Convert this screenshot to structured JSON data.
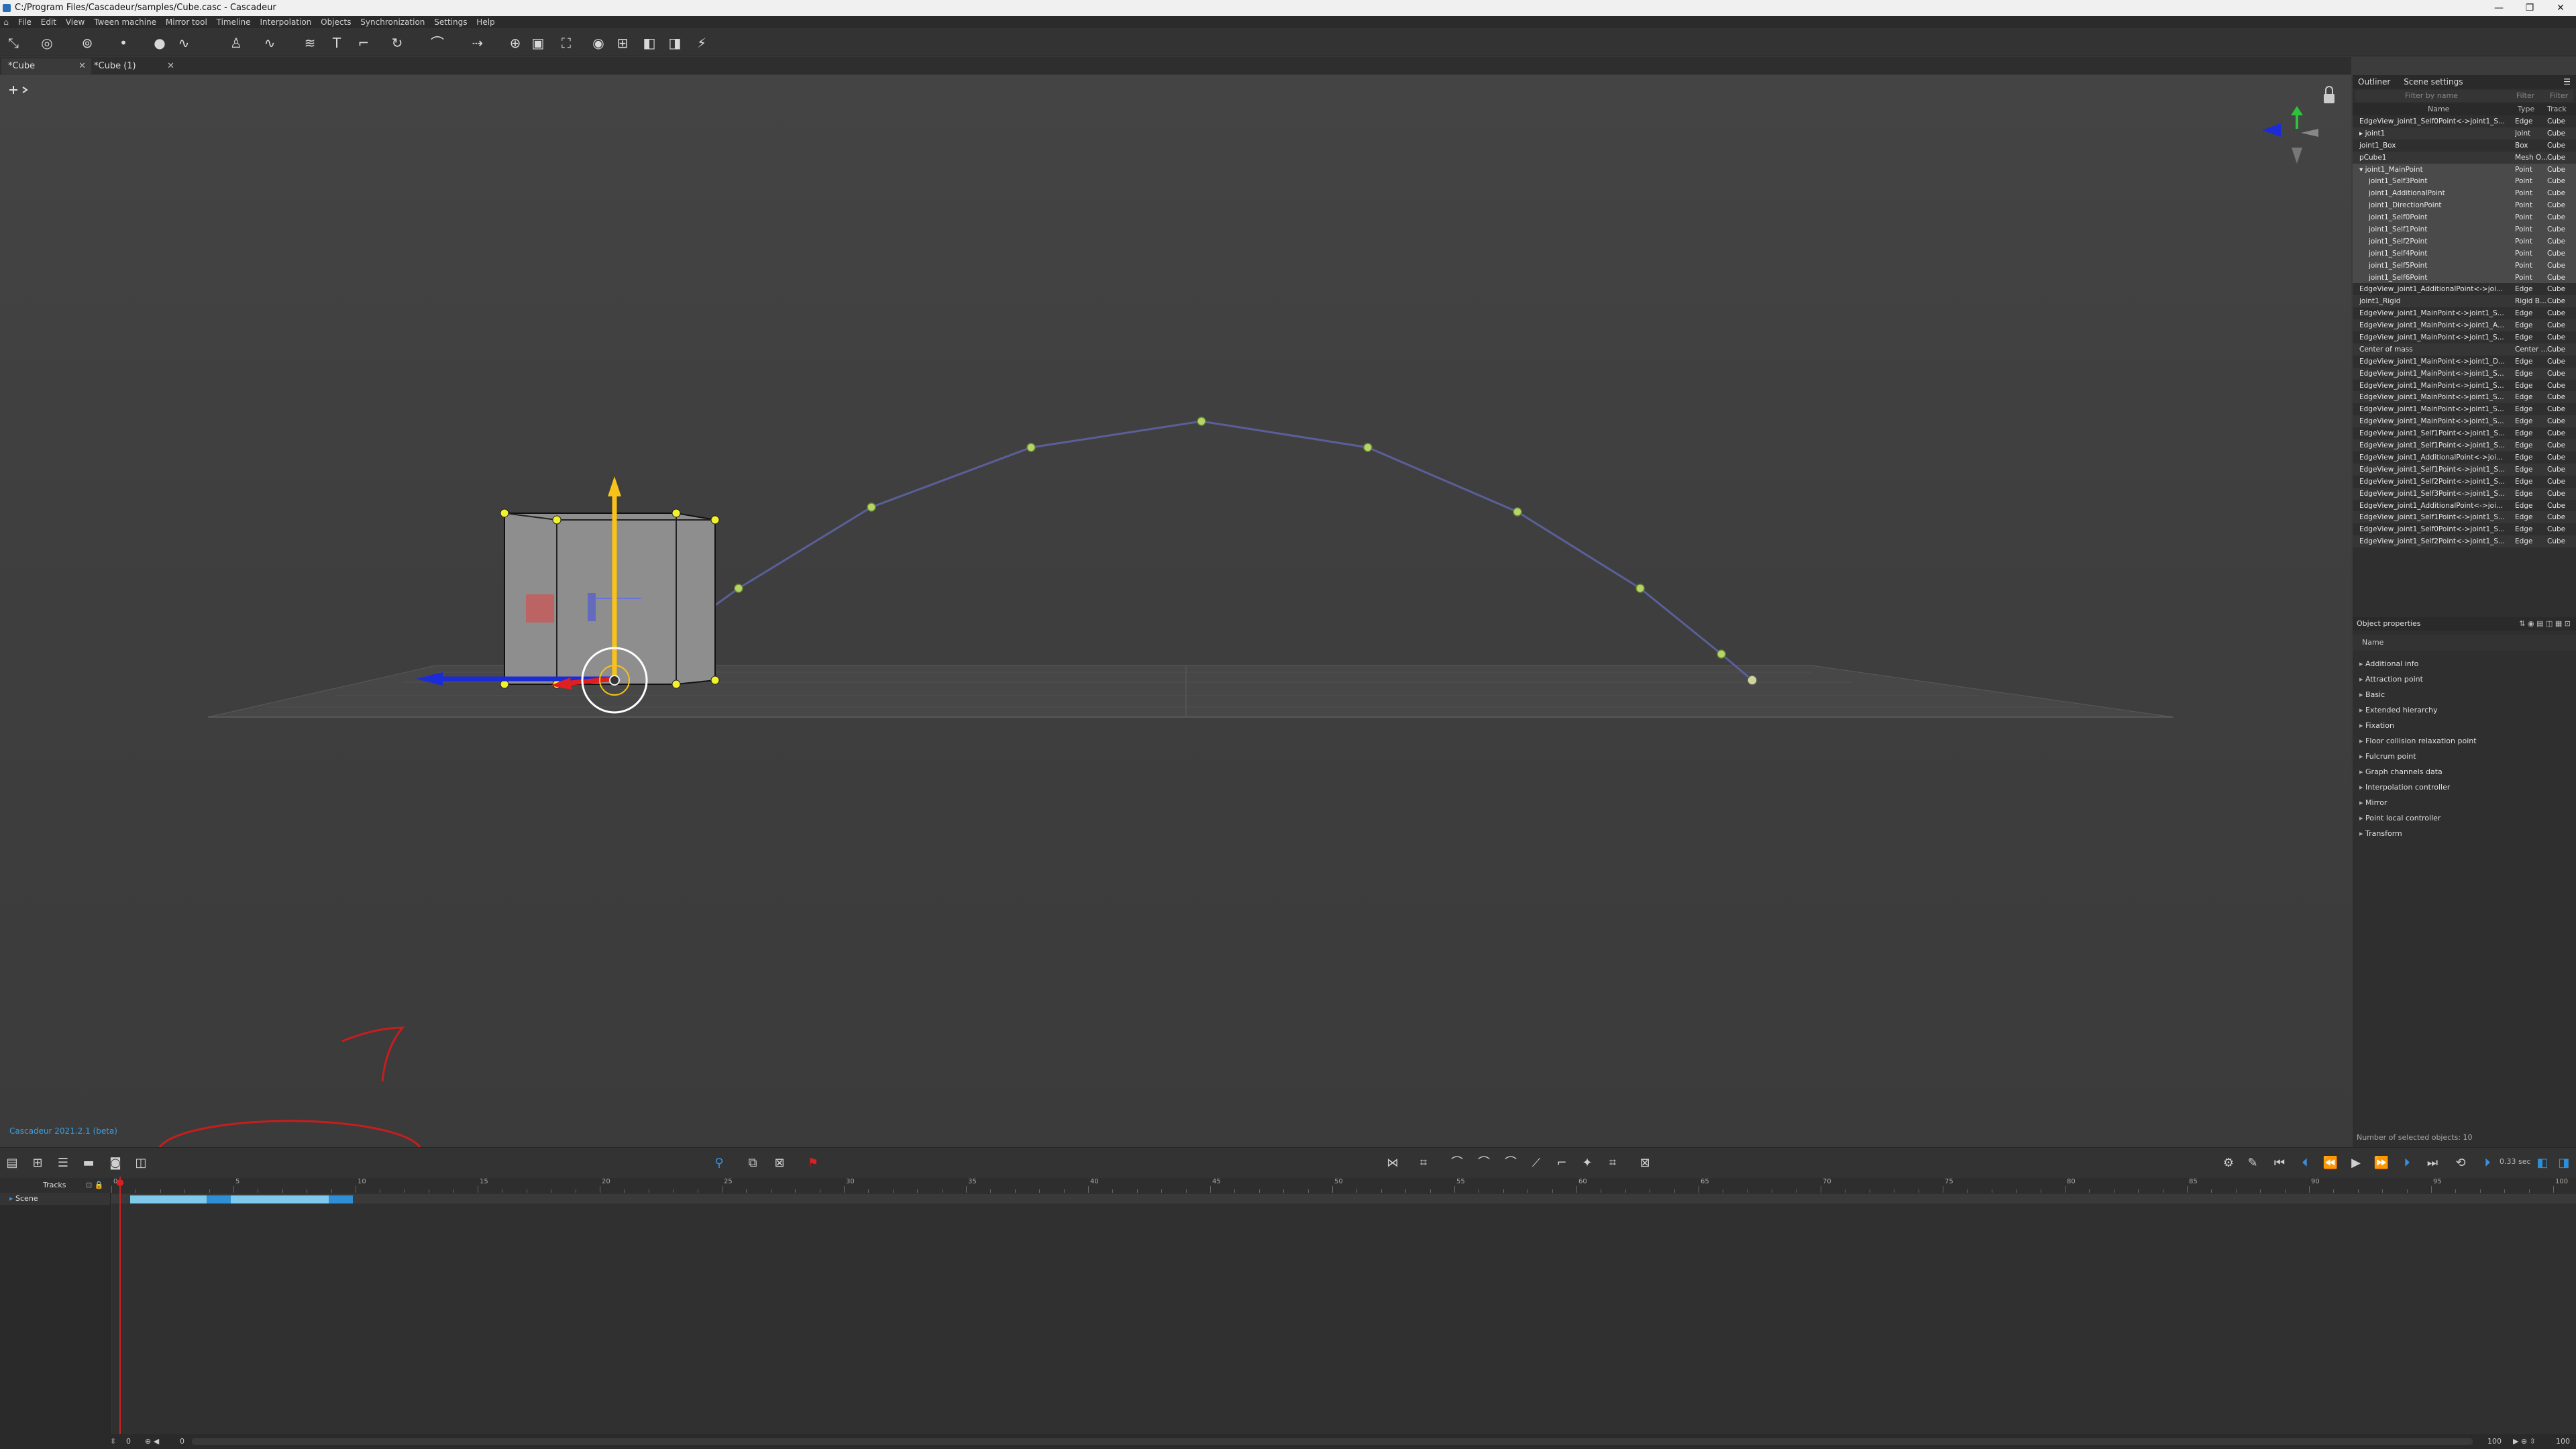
{
  "window": {
    "title": "C:/Program Files/Cascadeur/samples/Cube.casc - Cascadeur",
    "controls": [
      "—",
      "❐",
      "✕"
    ]
  },
  "menu": {
    "items": [
      "File",
      "Edit",
      "View",
      "Tween machine",
      "Mirror tool",
      "Timeline",
      "Interpolation",
      "Objects",
      "Synchronization",
      "Settings",
      "Help"
    ]
  },
  "tabs": [
    {
      "label": "*Cube",
      "close": "✕"
    },
    {
      "label": "*Cube (1)",
      "close": "✕"
    }
  ],
  "viewport": {
    "version_text": "Cascadeur 2021.2.1 (beta)"
  },
  "outliner": {
    "tabs": [
      "Outliner",
      "Scene settings"
    ],
    "filter_placeholder": "Filter by name",
    "filter_labels": [
      "Filter",
      "Filter"
    ],
    "columns": {
      "name": "Name",
      "type": "Type",
      "track": "Track"
    },
    "rows": [
      {
        "name": "EdgeView_joint1_Self0Point<->joint1_S...",
        "type": "Edge",
        "track": "Cube"
      },
      {
        "name": "▸ joint1",
        "type": "Joint",
        "track": "Cube"
      },
      {
        "name": "joint1_Box",
        "type": "Box",
        "track": "Cube"
      },
      {
        "name": "pCube1",
        "type": "Mesh O...",
        "track": "Cube"
      },
      {
        "name": "▾ joint1_MainPoint",
        "type": "Point",
        "track": "Cube"
      },
      {
        "name": "joint1_Self3Point",
        "type": "Point",
        "track": "Cube"
      },
      {
        "name": "joint1_AdditionalPoint",
        "type": "Point",
        "track": "Cube"
      },
      {
        "name": "joint1_DirectionPoint",
        "type": "Point",
        "track": "Cube"
      },
      {
        "name": "joint1_Self0Point",
        "type": "Point",
        "track": "Cube"
      },
      {
        "name": "joint1_Self1Point",
        "type": "Point",
        "track": "Cube"
      },
      {
        "name": "joint1_Self2Point",
        "type": "Point",
        "track": "Cube"
      },
      {
        "name": "joint1_Self4Point",
        "type": "Point",
        "track": "Cube"
      },
      {
        "name": "joint1_Self5Point",
        "type": "Point",
        "track": "Cube"
      },
      {
        "name": "joint1_Self6Point",
        "type": "Point",
        "track": "Cube"
      },
      {
        "name": "EdgeView_joint1_AdditionalPoint<->joi...",
        "type": "Edge",
        "track": "Cube"
      },
      {
        "name": "joint1_Rigid",
        "type": "Rigid B...",
        "track": "Cube"
      },
      {
        "name": "EdgeView_joint1_MainPoint<->joint1_S...",
        "type": "Edge",
        "track": "Cube"
      },
      {
        "name": "EdgeView_joint1_MainPoint<->joint1_A...",
        "type": "Edge",
        "track": "Cube"
      },
      {
        "name": "EdgeView_joint1_MainPoint<->joint1_S...",
        "type": "Edge",
        "track": "Cube"
      },
      {
        "name": "Center of mass",
        "type": "Center ...",
        "track": "Cube"
      },
      {
        "name": "EdgeView_joint1_MainPoint<->joint1_D...",
        "type": "Edge",
        "track": "Cube"
      },
      {
        "name": "EdgeView_joint1_MainPoint<->joint1_S...",
        "type": "Edge",
        "track": "Cube"
      },
      {
        "name": "EdgeView_joint1_MainPoint<->joint1_S...",
        "type": "Edge",
        "track": "Cube"
      },
      {
        "name": "EdgeView_joint1_MainPoint<->joint1_S...",
        "type": "Edge",
        "track": "Cube"
      },
      {
        "name": "EdgeView_joint1_MainPoint<->joint1_S...",
        "type": "Edge",
        "track": "Cube"
      },
      {
        "name": "EdgeView_joint1_MainPoint<->joint1_S...",
        "type": "Edge",
        "track": "Cube"
      },
      {
        "name": "EdgeView_joint1_Self1Point<->joint1_S...",
        "type": "Edge",
        "track": "Cube"
      },
      {
        "name": "EdgeView_joint1_Self1Point<->joint1_S...",
        "type": "Edge",
        "track": "Cube"
      },
      {
        "name": "EdgeView_joint1_AdditionalPoint<->joi...",
        "type": "Edge",
        "track": "Cube"
      },
      {
        "name": "EdgeView_joint1_Self1Point<->joint1_S...",
        "type": "Edge",
        "track": "Cube"
      },
      {
        "name": "EdgeView_joint1_Self2Point<->joint1_S...",
        "type": "Edge",
        "track": "Cube"
      },
      {
        "name": "EdgeView_joint1_Self3Point<->joint1_S...",
        "type": "Edge",
        "track": "Cube"
      },
      {
        "name": "EdgeView_joint1_AdditionalPoint<->joi...",
        "type": "Edge",
        "track": "Cube"
      },
      {
        "name": "EdgeView_joint1_Self1Point<->joint1_S...",
        "type": "Edge",
        "track": "Cube"
      },
      {
        "name": "EdgeView_joint1_Self0Point<->joint1_S...",
        "type": "Edge",
        "track": "Cube"
      },
      {
        "name": "EdgeView_joint1_Self2Point<->joint1_S...",
        "type": "Edge",
        "track": "Cube"
      }
    ]
  },
  "properties": {
    "title": "Object properties",
    "name_label": "Name",
    "categories": [
      "Additional info",
      "Attraction point",
      "Basic",
      "Extended hierarchy",
      "Fixation",
      "Floor collision relaxation point",
      "Fulcrum point",
      "Graph channels data",
      "Interpolation controller",
      "Mirror",
      "Point local controller",
      "Transform"
    ],
    "status": "Number of selected objects: 10"
  },
  "timeline": {
    "tracks_label": "Tracks",
    "scene_label": "Scene",
    "ruler_labels": [
      "0",
      "5",
      "10",
      "15",
      "20",
      "25",
      "30",
      "35",
      "40",
      "45",
      "50",
      "55",
      "60",
      "65",
      "70",
      "75",
      "80",
      "85",
      "90",
      "95",
      "100"
    ],
    "speed_text": "0.33 sec",
    "bottom_left": [
      "0",
      "0"
    ],
    "bottom_right": [
      "100",
      "100"
    ]
  },
  "colors": {
    "accent_blue": "#2f8fd6",
    "keyframe_blue": "#4fb3e6",
    "trajectory": "#5a5f9a",
    "point_green": "#b5d56a",
    "point_yellow": "#f1f12c",
    "axis_red": "#e02020",
    "axis_blue": "#1c2bd8",
    "axis_yellow": "#f7c21a"
  }
}
